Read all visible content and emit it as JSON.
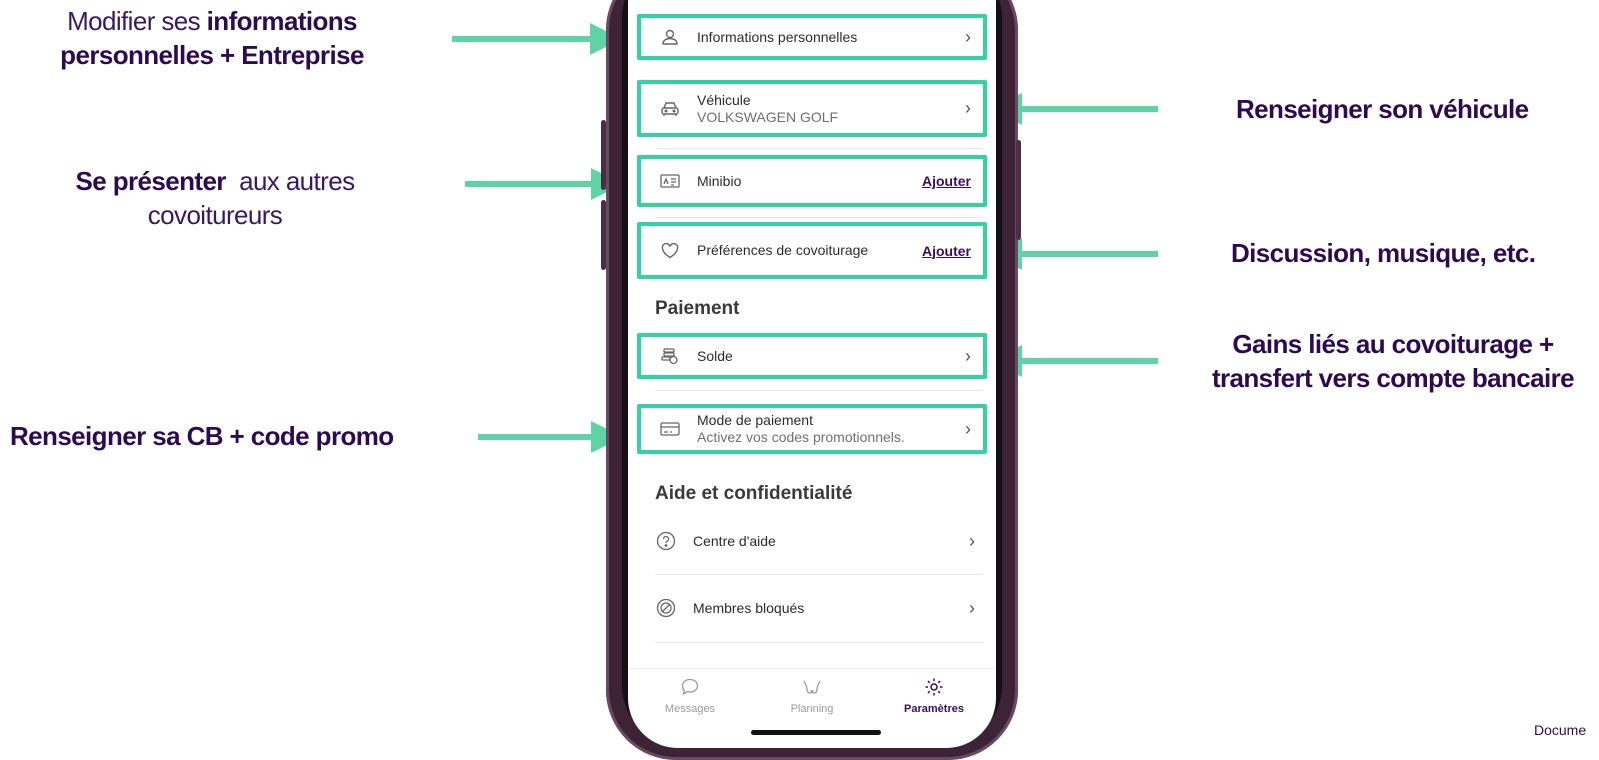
{
  "annotations": {
    "perso_line1_light": "Modifier ses ",
    "perso_line1_bold": "informations",
    "perso_line2": "personnelles + Entreprise",
    "vehicle": "Renseigner son véhicule",
    "bio_bold": "Se présenter",
    "bio_light": "aux autres",
    "bio_line2": "covoitureurs",
    "prefs": "Discussion, musique, etc.",
    "solde_line1": "Gains liés au covoiturage +",
    "solde_line2": "transfert vers compte bancaire",
    "payment": "Renseigner sa CB + code promo"
  },
  "profile": {
    "personal_info": "Informations personnelles",
    "vehicle_label": "Véhicule",
    "vehicle_value": "VOLKSWAGEN GOLF",
    "minibio": "Minibio",
    "minibio_action": "Ajouter",
    "prefs": "Préférences de covoiturage",
    "prefs_action": "Ajouter"
  },
  "payment": {
    "section_title": "Paiement",
    "balance": "Solde",
    "method_label": "Mode de paiement",
    "method_sub": "Activez vos codes promotionnels."
  },
  "help": {
    "section_title": "Aide et confidentialité",
    "help_center": "Centre d'aide",
    "blocked": "Membres bloqués"
  },
  "tabs": [
    {
      "label": "Messages",
      "icon": "chat-bubble-icon"
    },
    {
      "label": "Planning",
      "icon": "planning-icon"
    },
    {
      "label": "Paramètres",
      "icon": "gear-icon"
    }
  ],
  "footer_note": "Docume",
  "colors": {
    "accent_green": "#33d1a3",
    "brand_purple": "#2d0b4e"
  }
}
